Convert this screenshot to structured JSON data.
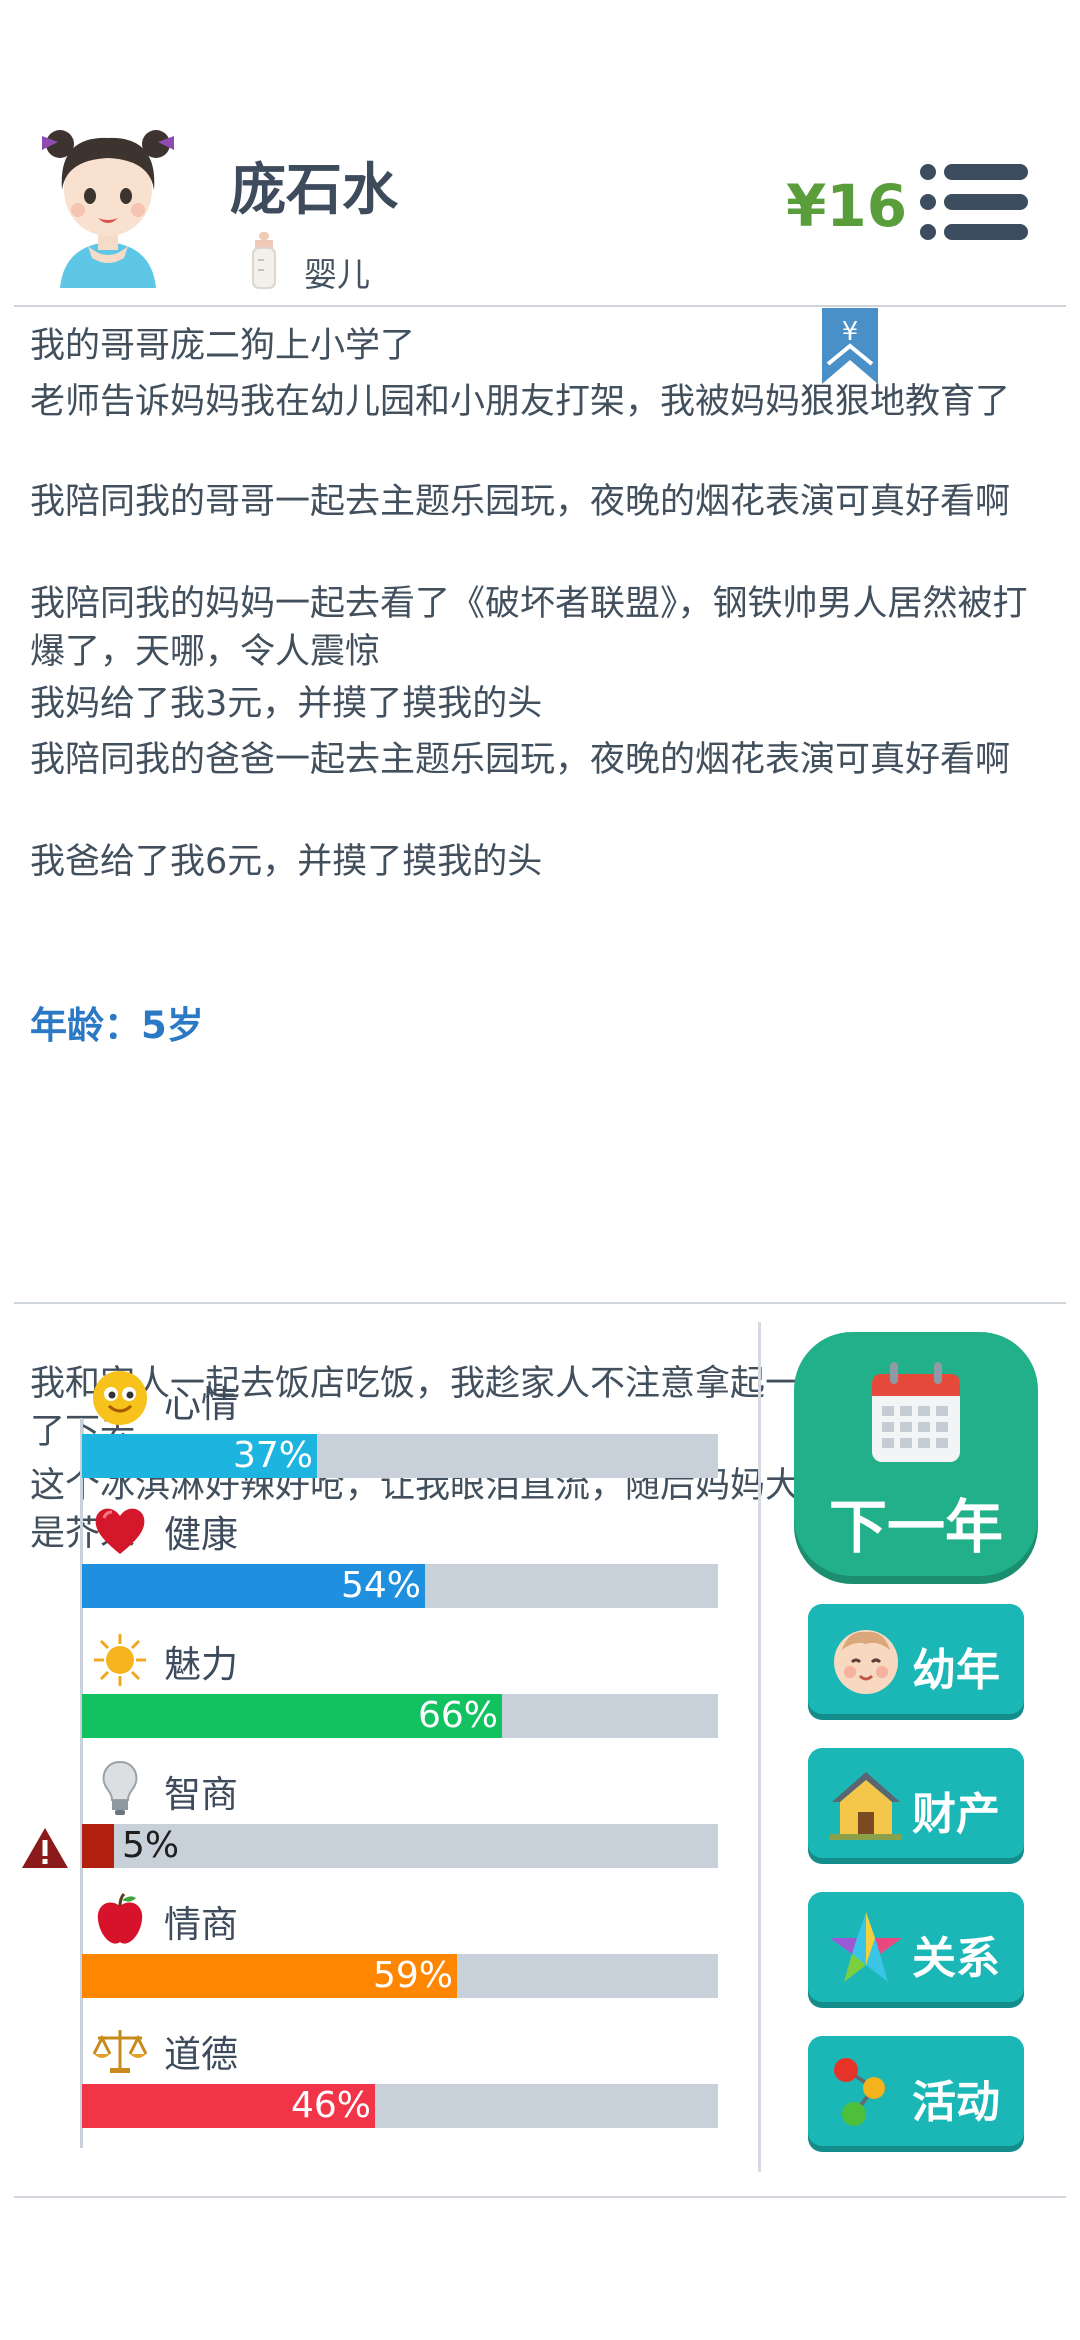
{
  "header": {
    "name": "庞石水",
    "stage": "婴儿",
    "money": "¥16",
    "bookmark_symbol": "¥"
  },
  "log": {
    "lines": [
      "我的哥哥庞二狗上小学了",
      "老师告诉妈妈我在幼儿园和小朋友打架，我被妈妈狠狠地教育了",
      "我陪同我的哥哥一起去主题乐园玩，夜晚的烟花表演可真好看啊",
      "我陪同我的妈妈一起去看了《破坏者联盟》，钢铁帅男人居然被打爆了，天哪，令人震惊",
      "我妈给了我3元，并摸了摸我的头",
      "我陪同我的爸爸一起去主题乐园玩，夜晚的烟花表演可真好看啊",
      "我爸给了我6元，并摸了摸我的头"
    ],
    "age_title": "年龄：5岁",
    "age_lines": [
      "我和家人一起去饭店吃饭，我趁家人不注意拿起一旁的冰淇淋吃了下去",
      "这个冰淇淋好辣好呛，让我眼泪直流，随后妈妈大笑着告诉我这是芥末"
    ]
  },
  "stats": [
    {
      "label": "心情",
      "value": 37,
      "pct": "37%",
      "color": "#1db4e0",
      "icon": "smiley-icon"
    },
    {
      "label": "健康",
      "value": 54,
      "pct": "54%",
      "color": "#1f8fe0",
      "icon": "heart-icon"
    },
    {
      "label": "魅力",
      "value": 66,
      "pct": "66%",
      "color": "#12c160",
      "icon": "sun-icon"
    },
    {
      "label": "智商",
      "value": 5,
      "pct": "5%",
      "color": "#b3200f",
      "icon": "lightbulb-icon",
      "warning": true
    },
    {
      "label": "情商",
      "value": 59,
      "pct": "59%",
      "color": "#ff8600",
      "icon": "apple-icon"
    },
    {
      "label": "道德",
      "value": 46,
      "pct": "46%",
      "color": "#f23448",
      "icon": "scales-icon"
    }
  ],
  "buttons": {
    "next_year": "下一年",
    "side": [
      {
        "label": "幼年",
        "icon": "baby-face-icon"
      },
      {
        "label": "财产",
        "icon": "house-icon"
      },
      {
        "label": "关系",
        "icon": "star-icon"
      },
      {
        "label": "活动",
        "icon": "activity-dots-icon"
      }
    ]
  }
}
